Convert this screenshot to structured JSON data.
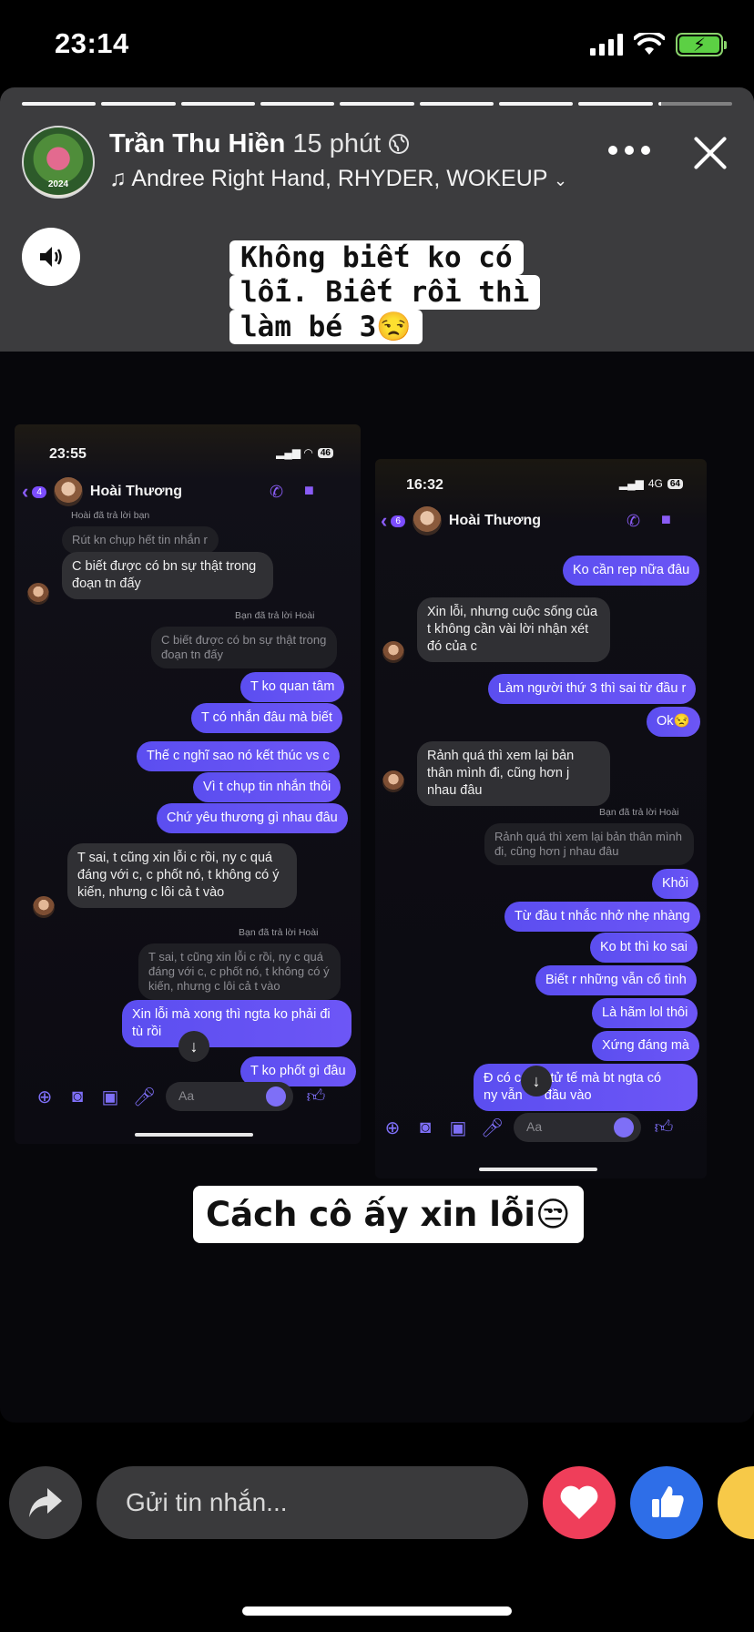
{
  "status_bar": {
    "time": "23:14"
  },
  "story": {
    "owner_name": "Trần Thu Hiền",
    "posted_ago": "15 phút",
    "music": "Andree Right Hand, RHYDER, WOKEUP",
    "avatar_year": "2024",
    "caption_top_lines": [
      "Không biết ko có",
      "lỗi. Biết rồi thì",
      "làm bé 3😒"
    ],
    "caption_bottom": "Cách cô ấy xin lỗi😒",
    "progress_segments": 9
  },
  "screenshot_left": {
    "time": "23:55",
    "battery": "46",
    "back_badge": "4",
    "contact_name": "Hoài Thương",
    "composer_placeholder": "Aa",
    "reply_label_1": "Hoài đã trả lời bạn",
    "quote_1": "Rút kn chụp hết tin nhắn r",
    "msg_in_1": "C biết được có bn sự thật trong đoạn tn đấy",
    "reply_label_2": "Bạn đã trả lời Hoài",
    "quote_2": "C biết được có bn sự thật trong đoạn tn đấy",
    "msg_out_1": "T ko quan tâm",
    "msg_out_2": "T có nhắn đâu mà biết",
    "msg_out_3": "Thế c nghĩ sao nó kết thúc vs c",
    "msg_out_4": "Vì t chụp tin nhắn thôi",
    "msg_out_5": "Chứ yêu thương gì nhau đâu",
    "msg_in_2": "T sai, t cũng xin lỗi c rồi, ny c quá đáng với c, c phốt nó, t không có ý kiến, nhưng c lôi cả t vào",
    "reply_label_3": "Bạn đã trả lời Hoài",
    "quote_3": "T sai, t cũng xin lỗi c rồi, ny c quá đáng với c, c phốt nó, t không có ý kiến, nhưng c lôi cả t vào",
    "msg_out_6": "Xin lỗi mà xong thì ngta ko phải đi tù rồi",
    "msg_out_7": "T ko phốt gì đâu"
  },
  "screenshot_right": {
    "time": "16:32",
    "network": "4G",
    "battery": "64",
    "back_badge": "6",
    "contact_name": "Hoài Thương",
    "composer_placeholder": "Aa",
    "msg_out_1": "Ko cần rep nữa đâu",
    "msg_in_1": "Xin lỗi, nhưng cuộc sống của t không cần vài lời nhận xét đó của c",
    "msg_out_2": "Làm người thứ 3 thì sai từ đầu r",
    "msg_out_3": "Ok😒",
    "msg_in_2": "Rảnh quá thì xem lại bản thân mình đi, cũng hơn j nhau đâu",
    "reply_label_1": "Bạn đã trả lời Hoài",
    "quote_1": "Rảnh quá thì xem lại bản thân mình đi, cũng hơn j nhau đâu",
    "msg_out_4": "Khỏi",
    "msg_out_5": "Từ đầu t nhắc nhở nhẹ nhàng",
    "msg_out_6": "Ko bt thì ko sai",
    "msg_out_7": "Biết r những vẫn cố tình",
    "msg_out_8": "Là hãm lol thôi",
    "msg_out_9": "Xứng đáng mà",
    "msg_out_10_a": "Đ có c",
    "msg_out_10_b": "o tử tế mà bt ngta có",
    "msg_out_10_c": "ny vẫn",
    "msg_out_10_d": "đầu vào"
  },
  "reply_bar": {
    "placeholder": "Gửi tin nhắn..."
  },
  "colors": {
    "messenger_accent": "#7c4dff",
    "heart": "#ef3e5a",
    "like": "#2e6ee8"
  },
  "icons": [
    "signal-icon",
    "wifi-icon",
    "battery-icon",
    "globe-icon",
    "music-icon",
    "more-icon",
    "close-icon",
    "speaker-icon",
    "share-icon",
    "heart-icon",
    "like-icon",
    "haha-icon"
  ]
}
